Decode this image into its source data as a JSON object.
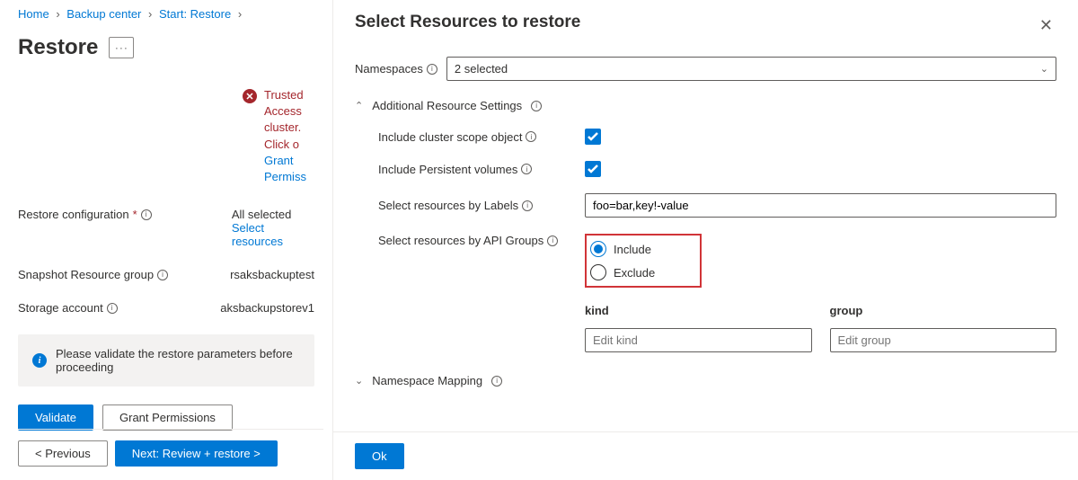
{
  "breadcrumb": {
    "home": "Home",
    "backup_center": "Backup center",
    "start_restore": "Start: Restore"
  },
  "page": {
    "title": "Restore",
    "more_label": "···"
  },
  "error": {
    "line1": "Trusted Access",
    "line2": "cluster. Click o",
    "link": "Grant Permiss"
  },
  "form": {
    "restore_config_label": "Restore configuration",
    "restore_config_value": "All selected",
    "select_resources_link": "Select resources",
    "snapshot_rg_label": "Snapshot Resource group",
    "snapshot_rg_value": "rsaksbackuptest",
    "storage_label": "Storage account",
    "storage_value": "aksbackupstorev1"
  },
  "banner": {
    "text": "Please validate the restore parameters before proceeding"
  },
  "buttons": {
    "validate": "Validate",
    "grant": "Grant Permissions",
    "previous": "< Previous",
    "next": "Next: Review + restore >"
  },
  "blade": {
    "title": "Select Resources to restore",
    "namespaces_label": "Namespaces",
    "namespaces_value": "2 selected",
    "section_additional": "Additional Resource Settings",
    "include_cluster_scope": "Include cluster scope object",
    "include_pv": "Include Persistent volumes",
    "select_by_labels": "Select resources by Labels",
    "labels_value": "foo=bar,key!-value",
    "select_by_api": "Select resources by API Groups",
    "radio_include": "Include",
    "radio_exclude": "Exclude",
    "col_kind": "kind",
    "col_group": "group",
    "kind_placeholder": "Edit kind",
    "group_placeholder": "Edit group",
    "section_ns_mapping": "Namespace Mapping",
    "ok": "Ok"
  }
}
